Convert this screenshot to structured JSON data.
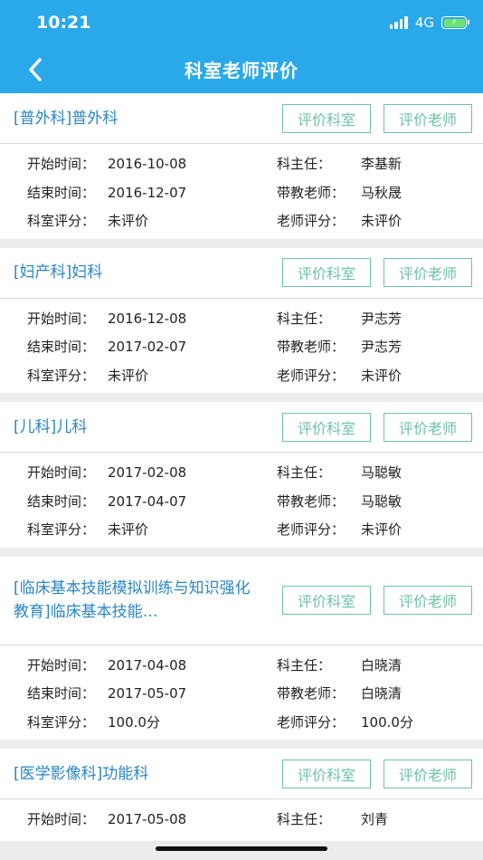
{
  "status_bar": {
    "time": "10:21",
    "network": "4G"
  },
  "nav": {
    "title": "科室老师评价"
  },
  "buttons": {
    "rate_dept": "评价科室",
    "rate_teacher": "评价老师"
  },
  "labels": {
    "start": "开始时间：",
    "end": "结束时间：",
    "dept_score": "科室评分：",
    "director": "科主任：",
    "teacher": "带教老师：",
    "teacher_score": "老师评分："
  },
  "cards": [
    {
      "title": "[普外科]普外科",
      "start": "2016-10-08",
      "end": "2016-12-07",
      "dept_score": "未评价",
      "director": "李基新",
      "teacher": "马秋晟",
      "teacher_score": "未评价"
    },
    {
      "title": "[妇产科]妇科",
      "start": "2016-12-08",
      "end": "2017-02-07",
      "dept_score": "未评价",
      "director": "尹志芳",
      "teacher": "尹志芳",
      "teacher_score": "未评价"
    },
    {
      "title": "[儿科]儿科",
      "start": "2017-02-08",
      "end": "2017-04-07",
      "dept_score": "未评价",
      "director": "马聪敏",
      "teacher": "马聪敏",
      "teacher_score": "未评价"
    },
    {
      "title": "[临床基本技能模拟训练与知识强化教育]临床基本技能…",
      "start": "2017-04-08",
      "end": "2017-05-07",
      "dept_score": "100.0分",
      "director": "白晓清",
      "teacher": "白晓清",
      "teacher_score": "100.0分"
    },
    {
      "title": "[医学影像科]功能科",
      "start": "2017-05-08",
      "director": "刘青"
    }
  ]
}
